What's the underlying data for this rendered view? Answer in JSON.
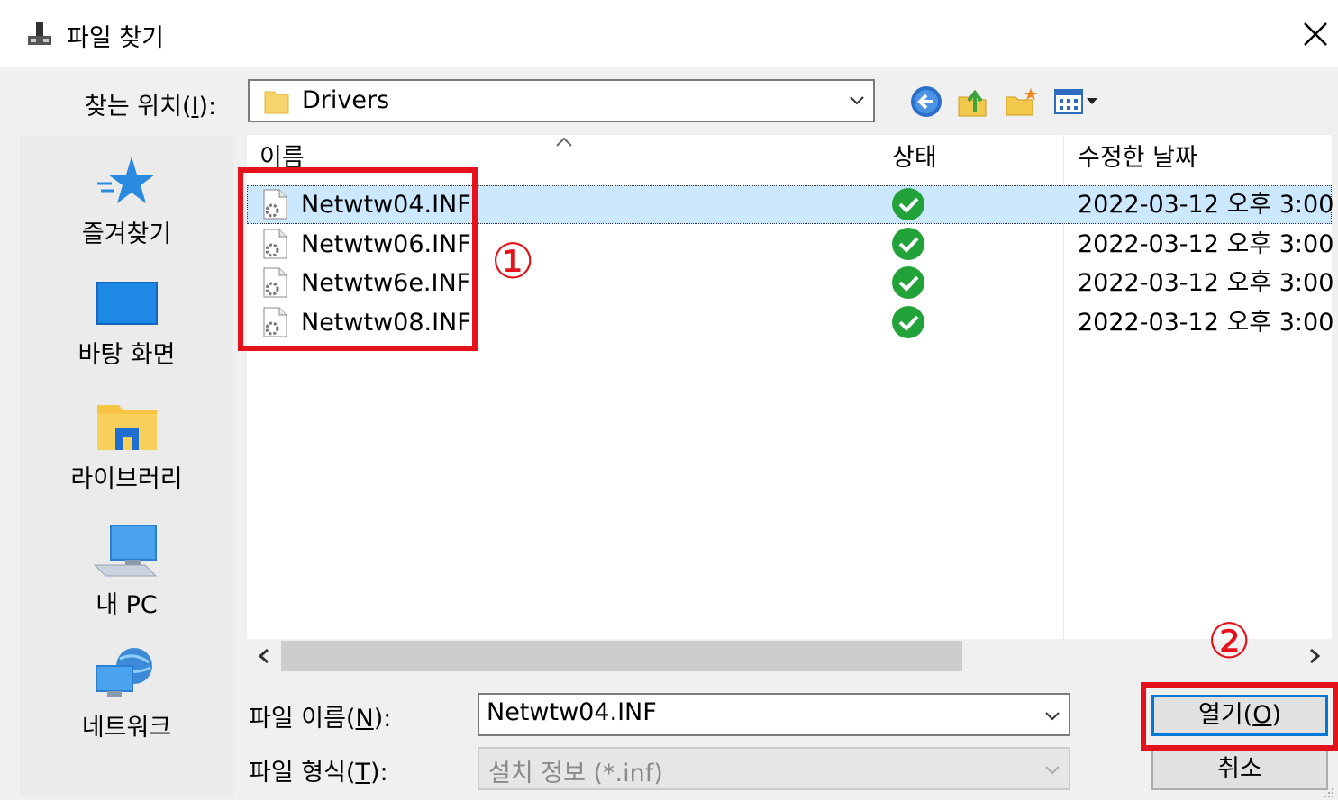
{
  "title": "파일 찾기",
  "look_in": {
    "label_before": "찾는 위치(",
    "label_key": "I",
    "label_after": "):",
    "value": "Drivers"
  },
  "toolbar": {
    "icons": [
      "back-icon",
      "up-folder-icon",
      "new-folder-icon",
      "view-menu-icon"
    ]
  },
  "places": [
    {
      "label": "즐겨찾기",
      "icon": "favorites-star-icon"
    },
    {
      "label": "바탕 화면",
      "icon": "desktop-icon"
    },
    {
      "label": "라이브러리",
      "icon": "library-icon"
    },
    {
      "label": "내 PC",
      "icon": "computer-icon"
    },
    {
      "label": "네트워크",
      "icon": "network-icon"
    }
  ],
  "columns": {
    "name": "이름",
    "status": "상태",
    "date": "수정한 날짜"
  },
  "files": [
    {
      "name": "Netwtw04.INF",
      "date": "2022-03-12 오후 3:00",
      "selected": true
    },
    {
      "name": "Netwtw06.INF",
      "date": "2022-03-12 오후 3:00",
      "selected": false
    },
    {
      "name": "Netwtw6e.INF",
      "date": "2022-03-12 오후 3:00",
      "selected": false
    },
    {
      "name": "Netwtw08.INF",
      "date": "2022-03-12 오후 3:00",
      "selected": false
    }
  ],
  "file_name": {
    "label_before": "파일 이름(",
    "label_key": "N",
    "label_after": "):",
    "value": "Netwtw04.INF"
  },
  "file_type": {
    "label_before": "파일 형식(",
    "label_key": "T",
    "label_after": "):",
    "value": "설치 정보 (*.inf)"
  },
  "buttons": {
    "open_before": "열기(",
    "open_key": "O",
    "open_after": ")",
    "cancel": "취소"
  },
  "annotations": {
    "callout_1": "①",
    "callout_2": "②"
  },
  "colors": {
    "highlight": "#e4121b",
    "selection": "#cce8ff",
    "status_ok": "#21a33a",
    "default_button_border": "#0078d7"
  }
}
